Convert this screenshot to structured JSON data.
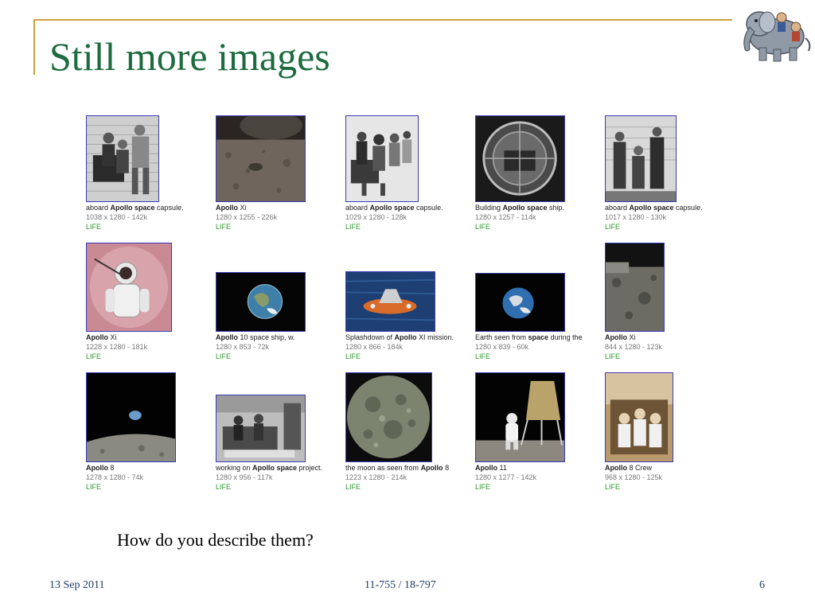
{
  "slide": {
    "title": "Still more images",
    "question": "How do you describe them?",
    "footer": {
      "date": "13 Sep 2011",
      "course": "11-755 / 18-797",
      "page": "6"
    }
  },
  "colors": {
    "title": "#1e6b3f",
    "frame": "#c8a23a",
    "thumb_border": "#3b3bb5",
    "source": "#2a9a2a",
    "meta": "#777777",
    "footer": "#1f3b6b"
  },
  "results": [
    {
      "pre": "aboard ",
      "bold": "Apollo space",
      "post": " capsule.",
      "meta": "1038 x 1280 - 142k",
      "source": "LIFE",
      "depicts": "family-group-photo-icon"
    },
    {
      "pre": "",
      "bold": "Apollo",
      "post": " Xi",
      "meta": "1280 x 1255 - 226k",
      "source": "LIFE",
      "depicts": "moon-footprint-icon"
    },
    {
      "pre": "aboard ",
      "bold": "Apollo space",
      "post": " capsule.",
      "meta": "1029 x 1280 - 128k",
      "source": "LIFE",
      "depicts": "family-group-photo-icon"
    },
    {
      "pre": "Building ",
      "bold": "Apollo space",
      "post": " ship.",
      "meta": "1280 x 1257 - 114k",
      "source": "LIFE",
      "depicts": "capsule-interior-icon"
    },
    {
      "pre": "aboard ",
      "bold": "Apollo space",
      "post": " capsule.",
      "meta": "1017 x 1280 - 130k",
      "source": "LIFE",
      "depicts": "family-group-photo-icon"
    },
    {
      "pre": "",
      "bold": "Apollo",
      "post": " Xi",
      "meta": "1228 x 1280 - 181k",
      "source": "LIFE",
      "depicts": "astronaut-icon"
    },
    {
      "pre": "",
      "bold": "Apollo",
      "post": " 10 space ship, w.",
      "meta": "1280 x 853 - 72k",
      "source": "LIFE",
      "depicts": "earth-icon"
    },
    {
      "pre": "Splashdown of ",
      "bold": "Apollo",
      "post": " XI mission.",
      "meta": "1280 x 866 - 184k",
      "source": "LIFE",
      "depicts": "splashdown-icon"
    },
    {
      "pre": "Earth seen from ",
      "bold": "space",
      "post": " during the",
      "meta": "1280 x 839 - 60k",
      "source": "LIFE",
      "depicts": "earth-icon"
    },
    {
      "pre": "",
      "bold": "Apollo",
      "post": " Xi",
      "meta": "844 x 1280 - 123k",
      "source": "LIFE",
      "depicts": "lunar-surface-icon"
    },
    {
      "pre": "",
      "bold": "Apollo",
      "post": " 8",
      "meta": "1278 x 1280 - 74k",
      "source": "LIFE",
      "depicts": "earthrise-icon"
    },
    {
      "pre": "working on ",
      "bold": "Apollo space",
      "post": " project.",
      "meta": "1280 x 956 - 117k",
      "source": "LIFE",
      "depicts": "mission-control-icon"
    },
    {
      "pre": "the moon as seen from ",
      "bold": "Apollo",
      "post": " 8",
      "meta": "1223 x 1280 - 214k",
      "source": "LIFE",
      "depicts": "moon-icon"
    },
    {
      "pre": "",
      "bold": "Apollo",
      "post": " 11",
      "meta": "1280 x 1277 - 142k",
      "source": "LIFE",
      "depicts": "lunar-module-icon"
    },
    {
      "pre": "",
      "bold": "Apollo",
      "post": " 8 Crew",
      "meta": "968 x 1280 - 125k",
      "source": "LIFE",
      "depicts": "crew-portrait-icon"
    }
  ]
}
